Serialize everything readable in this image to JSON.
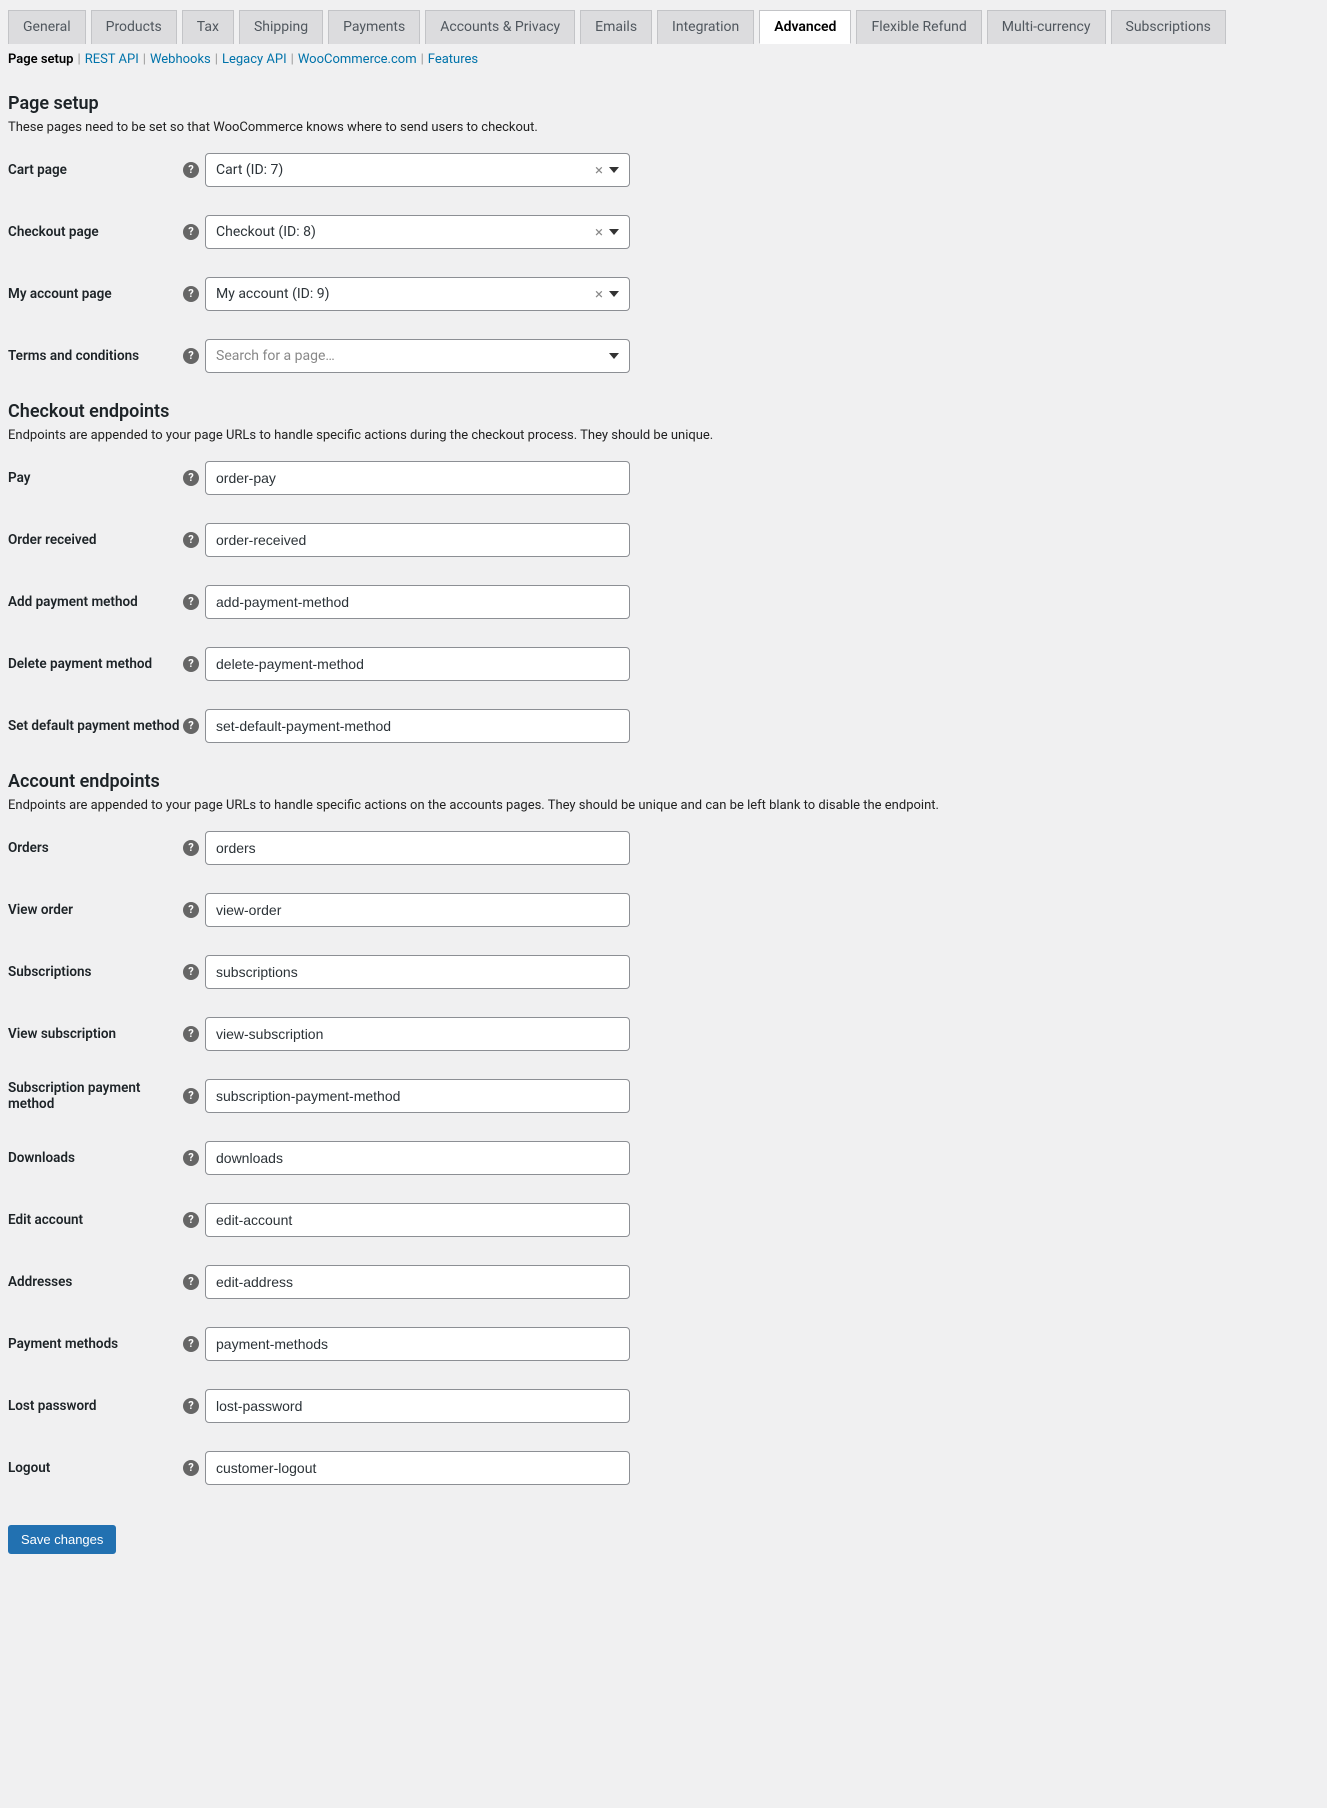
{
  "tabs": [
    {
      "label": "General"
    },
    {
      "label": "Products"
    },
    {
      "label": "Tax"
    },
    {
      "label": "Shipping"
    },
    {
      "label": "Payments"
    },
    {
      "label": "Accounts & Privacy"
    },
    {
      "label": "Emails"
    },
    {
      "label": "Integration"
    },
    {
      "label": "Advanced",
      "active": true
    },
    {
      "label": "Flexible Refund"
    },
    {
      "label": "Multi-currency"
    },
    {
      "label": "Subscriptions"
    }
  ],
  "subnav": [
    {
      "label": "Page setup",
      "active": true
    },
    {
      "label": "REST API"
    },
    {
      "label": "Webhooks"
    },
    {
      "label": "Legacy API"
    },
    {
      "label": "WooCommerce.com"
    },
    {
      "label": "Features"
    }
  ],
  "sections": {
    "pageSetup": {
      "heading": "Page setup",
      "desc": "These pages need to be set so that WooCommerce knows where to send users to checkout.",
      "rows": [
        {
          "label": "Cart page",
          "value": "Cart (ID: 7)",
          "clearable": true
        },
        {
          "label": "Checkout page",
          "value": "Checkout (ID: 8)",
          "clearable": true
        },
        {
          "label": "My account page",
          "value": "My account (ID: 9)",
          "clearable": true
        },
        {
          "label": "Terms and conditions",
          "placeholder": "Search for a page…",
          "clearable": false
        }
      ]
    },
    "checkoutEndpoints": {
      "heading": "Checkout endpoints",
      "desc": "Endpoints are appended to your page URLs to handle specific actions during the checkout process. They should be unique.",
      "rows": [
        {
          "label": "Pay",
          "value": "order-pay"
        },
        {
          "label": "Order received",
          "value": "order-received"
        },
        {
          "label": "Add payment method",
          "value": "add-payment-method"
        },
        {
          "label": "Delete payment method",
          "value": "delete-payment-method"
        },
        {
          "label": "Set default payment method",
          "value": "set-default-payment-method"
        }
      ]
    },
    "accountEndpoints": {
      "heading": "Account endpoints",
      "desc": "Endpoints are appended to your page URLs to handle specific actions on the accounts pages. They should be unique and can be left blank to disable the endpoint.",
      "rows": [
        {
          "label": "Orders",
          "value": "orders"
        },
        {
          "label": "View order",
          "value": "view-order"
        },
        {
          "label": "Subscriptions",
          "value": "subscriptions"
        },
        {
          "label": "View subscription",
          "value": "view-subscription"
        },
        {
          "label": "Subscription payment method",
          "value": "subscription-payment-method"
        },
        {
          "label": "Downloads",
          "value": "downloads"
        },
        {
          "label": "Edit account",
          "value": "edit-account"
        },
        {
          "label": "Addresses",
          "value": "edit-address"
        },
        {
          "label": "Payment methods",
          "value": "payment-methods"
        },
        {
          "label": "Lost password",
          "value": "lost-password"
        },
        {
          "label": "Logout",
          "value": "customer-logout"
        }
      ]
    }
  },
  "saveLabel": "Save changes"
}
